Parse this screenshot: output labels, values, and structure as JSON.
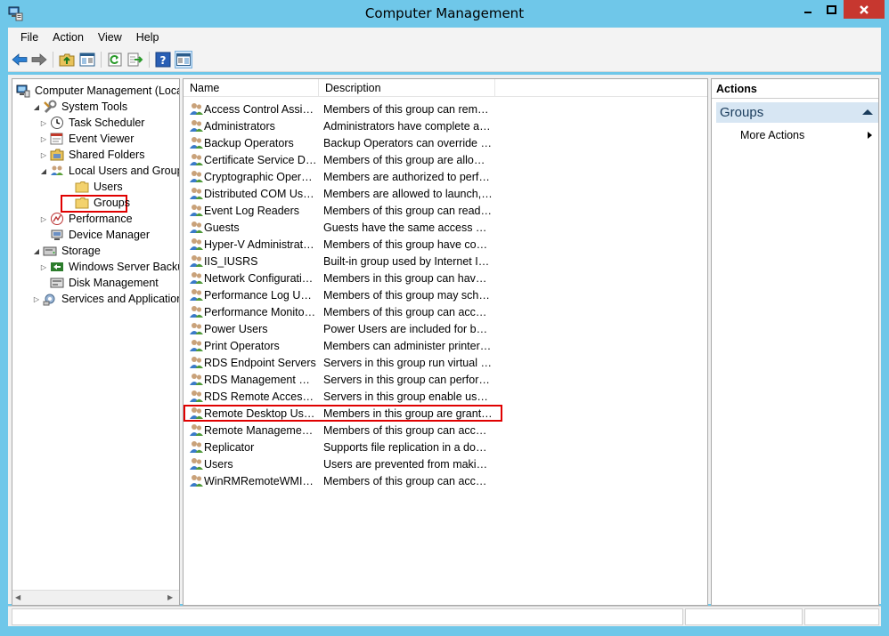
{
  "window": {
    "title": "Computer Management"
  },
  "menu": [
    "File",
    "Action",
    "View",
    "Help"
  ],
  "tree": {
    "items": [
      {
        "label": "Computer Management (Local",
        "level": 0,
        "expander": "",
        "icon": "computer-icon"
      },
      {
        "label": "System Tools",
        "level": 1,
        "expander": "down",
        "icon": "system-tools-icon"
      },
      {
        "label": "Task Scheduler",
        "level": 2,
        "expander": "right",
        "icon": "clock-icon"
      },
      {
        "label": "Event Viewer",
        "level": 2,
        "expander": "right",
        "icon": "event-viewer-icon"
      },
      {
        "label": "Shared Folders",
        "level": 2,
        "expander": "right",
        "icon": "shared-folder-icon"
      },
      {
        "label": "Local Users and Groups",
        "level": 2,
        "expander": "down",
        "icon": "users-icon"
      },
      {
        "label": "Users",
        "level": 3,
        "expander": "",
        "icon": "folder-icon"
      },
      {
        "label": "Groups",
        "level": 3,
        "expander": "",
        "icon": "folder-icon"
      },
      {
        "label": "Performance",
        "level": 2,
        "expander": "right",
        "icon": "performance-icon"
      },
      {
        "label": "Device Manager",
        "level": 2,
        "expander": "",
        "icon": "device-manager-icon"
      },
      {
        "label": "Storage",
        "level": 1,
        "expander": "down",
        "icon": "storage-icon"
      },
      {
        "label": "Windows Server Backup",
        "level": 2,
        "expander": "right",
        "icon": "backup-icon"
      },
      {
        "label": "Disk Management",
        "level": 2,
        "expander": "",
        "icon": "disk-icon"
      },
      {
        "label": "Services and Applications",
        "level": 1,
        "expander": "right",
        "icon": "services-icon"
      }
    ]
  },
  "list": {
    "columns": {
      "name": "Name",
      "description": "Description"
    },
    "rows": [
      {
        "name": "Access Control Assist...",
        "description": "Members of this group can remot..."
      },
      {
        "name": "Administrators",
        "description": "Administrators have complete an..."
      },
      {
        "name": "Backup Operators",
        "description": "Backup Operators can override se..."
      },
      {
        "name": "Certificate Service DC...",
        "description": "Members of this group are allowe..."
      },
      {
        "name": "Cryptographic Operat...",
        "description": "Members are authorized to perfor..."
      },
      {
        "name": "Distributed COM Users",
        "description": "Members are allowed to launch, a..."
      },
      {
        "name": "Event Log Readers",
        "description": "Members of this group can read e..."
      },
      {
        "name": "Guests",
        "description": "Guests have the same access as m..."
      },
      {
        "name": "Hyper-V Administrators",
        "description": "Members of this group have com..."
      },
      {
        "name": "IIS_IUSRS",
        "description": "Built-in group used by Internet Inf..."
      },
      {
        "name": "Network Configuratio...",
        "description": "Members in this group can have s..."
      },
      {
        "name": "Performance Log Users",
        "description": "Members of this group may sche..."
      },
      {
        "name": "Performance Monitor ...",
        "description": "Members of this group can acces..."
      },
      {
        "name": "Power Users",
        "description": "Power Users are included for back..."
      },
      {
        "name": "Print Operators",
        "description": "Members can administer printers ..."
      },
      {
        "name": "RDS Endpoint Servers",
        "description": "Servers in this group run virtual m..."
      },
      {
        "name": "RDS Management Ser...",
        "description": "Servers in this group can perform ..."
      },
      {
        "name": "RDS Remote Access S...",
        "description": "Servers in this group enable users ..."
      },
      {
        "name": "Remote Desktop Users",
        "description": "Members in this group are grante..."
      },
      {
        "name": "Remote Management...",
        "description": "Members of this group can acces..."
      },
      {
        "name": "Replicator",
        "description": "Supports file replication in a dom..."
      },
      {
        "name": "Users",
        "description": "Users are prevented from making ..."
      },
      {
        "name": "WinRMRemoteWMIU...",
        "description": "Members of this group can acces..."
      }
    ]
  },
  "actions": {
    "header": "Actions",
    "section": "Groups",
    "item": "More Actions"
  },
  "colors": {
    "frame": "#6fc7e9",
    "close": "#c7372f",
    "highlight": "#e00000",
    "section_bg": "#d7e6f3"
  }
}
